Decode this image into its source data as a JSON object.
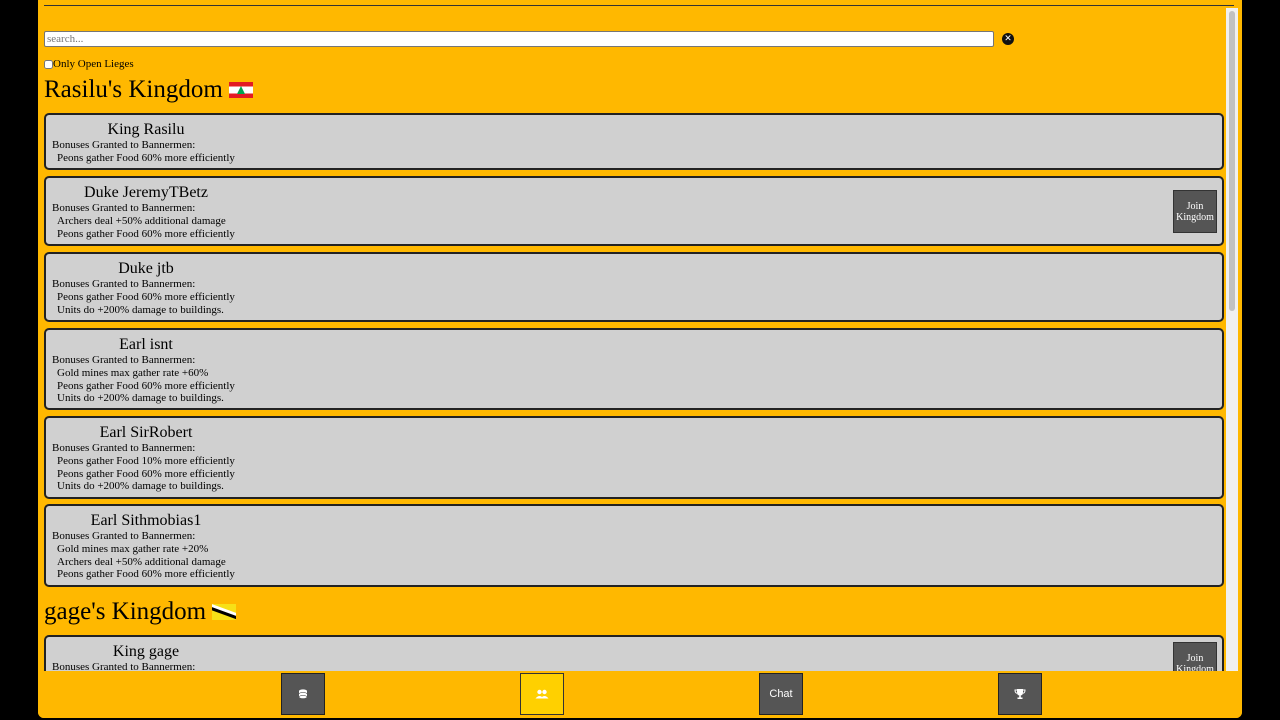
{
  "search": {
    "placeholder": "search...",
    "value": "",
    "clear_icon": "x-circle-icon"
  },
  "filter": {
    "label": "Only Open Lieges",
    "checked": false
  },
  "kingdoms": [
    {
      "title": "Rasilu's Kingdom",
      "flag": "lebanon-flag",
      "members": [
        {
          "name": "King Rasilu",
          "bonus_label": "Bonuses Granted to Bannermen:",
          "bonuses": [
            "Peons gather Food 60% more efficiently"
          ]
        },
        {
          "name": "Duke JeremyTBetz",
          "bonus_label": "Bonuses Granted to Bannermen:",
          "bonuses": [
            "Archers deal +50% additional damage",
            "Peons gather Food 60% more efficiently"
          ],
          "join_label": "Join Kingdom"
        },
        {
          "name": "Duke jtb",
          "bonus_label": "Bonuses Granted to Bannermen:",
          "bonuses": [
            "Peons gather Food 60% more efficiently",
            "Units do +200% damage to buildings."
          ]
        },
        {
          "name": "Earl isnt",
          "bonus_label": "Bonuses Granted to Bannermen:",
          "bonuses": [
            "Gold mines max gather rate +60%",
            "Peons gather Food 60% more efficiently",
            "Units do +200% damage to buildings."
          ]
        },
        {
          "name": "Earl SirRobert",
          "bonus_label": "Bonuses Granted to Bannermen:",
          "bonuses": [
            "Peons gather Food 10% more efficiently",
            "Peons gather Food 60% more efficiently",
            "Units do +200% damage to buildings."
          ]
        },
        {
          "name": "Earl Sithmobias1",
          "bonus_label": "Bonuses Granted to Bannermen:",
          "bonuses": [
            "Gold mines max gather rate +20%",
            "Archers deal +50% additional damage",
            "Peons gather Food 60% more efficiently"
          ]
        }
      ]
    },
    {
      "title": "gage's Kingdom",
      "flag": "brunei-flag",
      "members": [
        {
          "name": "King gage",
          "bonus_label": "Bonuses Granted to Bannermen:",
          "bonuses": [],
          "join_label": "Join Kingdom"
        }
      ]
    }
  ],
  "bottom_nav": [
    {
      "icon": "coins-icon",
      "active": false
    },
    {
      "icon": "users-icon",
      "active": true
    },
    {
      "label": "Chat",
      "active": false
    },
    {
      "icon": "trophy-icon",
      "active": false
    }
  ],
  "colors": {
    "background": "#FFB800",
    "card": "#D0D0D0",
    "button": "#555555",
    "active_button": "#FFD000"
  }
}
